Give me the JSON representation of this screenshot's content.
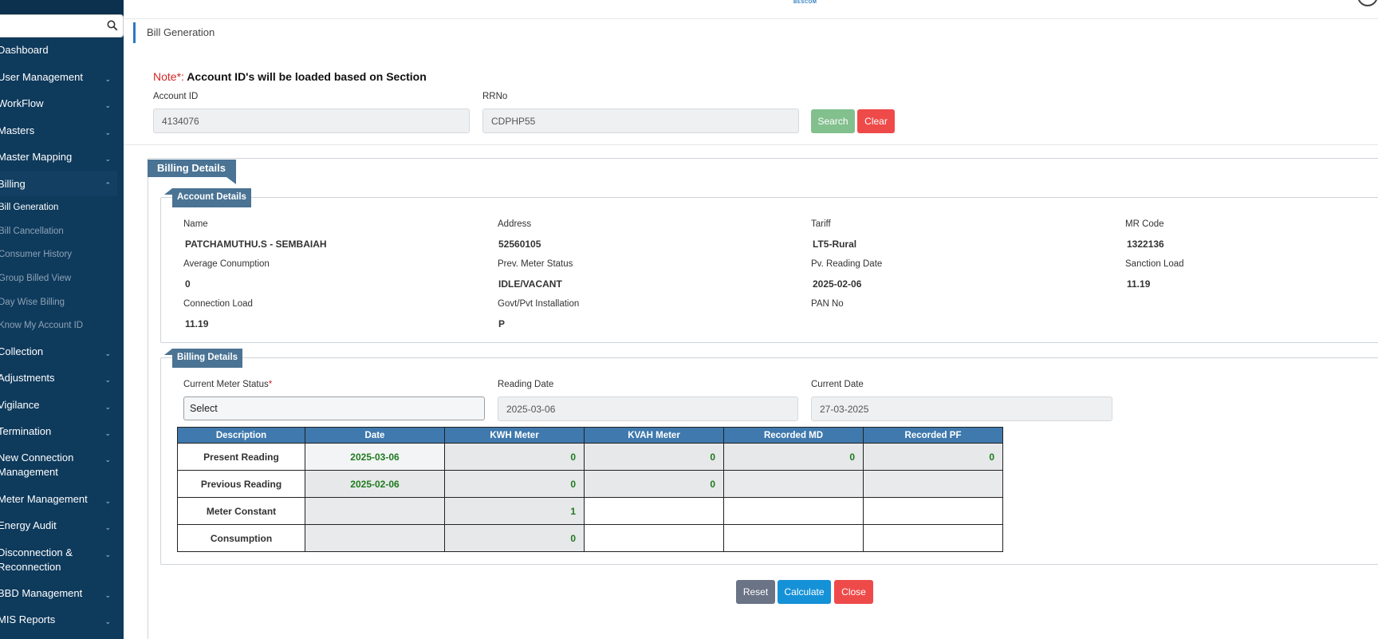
{
  "sidebar": {
    "search_placeholder": "",
    "items": [
      {
        "label": "Dashboard"
      },
      {
        "label": "User Management"
      },
      {
        "label": "WorkFlow"
      },
      {
        "label": "Masters"
      },
      {
        "label": "Master Mapping"
      },
      {
        "label": "Billing"
      },
      {
        "label": "Collection"
      },
      {
        "label": "Adjustments"
      },
      {
        "label": "Vigilance"
      },
      {
        "label": "Termination"
      },
      {
        "label": "New Connection"
      },
      {
        "label": "Management"
      },
      {
        "label": "Meter Management"
      },
      {
        "label": "Energy Audit"
      },
      {
        "label": "Disconnection &"
      },
      {
        "label": "Reconnection"
      },
      {
        "label": "BBD Management"
      },
      {
        "label": "MIS Reports"
      }
    ],
    "billing_sub": [
      {
        "label": "Bill Generation"
      },
      {
        "label": "Bill Cancellation"
      },
      {
        "label": "Consumer History"
      },
      {
        "label": "Group Billed View"
      },
      {
        "label": "Day Wise Billing"
      },
      {
        "label": "Know My Account ID"
      }
    ]
  },
  "header": {
    "logo_text": "BESCOM"
  },
  "breadcrumb": {
    "title": "Bill Generation"
  },
  "note": {
    "prefix": "Note*:",
    "text": " Account ID's will be loaded based on Section"
  },
  "search_form": {
    "account_id_label": "Account ID",
    "account_id_value": "4134076",
    "rrno_label": "RRNo",
    "rrno_value": "CDPHP55",
    "search_label": "Search",
    "clear_label": "Clear"
  },
  "billing_details_title": "Billing Details",
  "account_details": {
    "title": "Account Details",
    "fields": [
      {
        "label": "Name",
        "value": "PATCHAMUTHU.S - SEMBAIAH"
      },
      {
        "label": "Address",
        "value": "52560105"
      },
      {
        "label": "Tariff",
        "value": "LT5-Rural"
      },
      {
        "label": "MR Code",
        "value": "1322136"
      },
      {
        "label": "Average Conumption",
        "value": "0"
      },
      {
        "label": "Prev. Meter Status",
        "value": "IDLE/VACANT"
      },
      {
        "label": "Pv. Reading Date",
        "value": "2025-02-06"
      },
      {
        "label": "Sanction Load",
        "value": "11.19"
      },
      {
        "label": "Connection Load",
        "value": "11.19"
      },
      {
        "label": "Govt/Pvt Installation",
        "value": "P"
      },
      {
        "label": "PAN No",
        "value": ""
      }
    ]
  },
  "billing_form": {
    "title": "Billing Details",
    "meter_status_label": "Current Meter Status",
    "meter_status_required": "*",
    "meter_status_value": "Select",
    "reading_date_label": "Reading Date",
    "reading_date_value": "2025-03-06",
    "current_date_label": "Current Date",
    "current_date_value": "27-03-2025"
  },
  "readings_table": {
    "headers": [
      "Description",
      "Date",
      "KWH Meter",
      "KVAH Meter",
      "Recorded MD",
      "Recorded PF"
    ],
    "rows": [
      {
        "desc": "Present Reading",
        "date": "2025-03-06",
        "kwh": "0",
        "kvah": "0",
        "md": "0",
        "pf": "0"
      },
      {
        "desc": "Previous Reading",
        "date": "2025-02-06",
        "kwh": "0",
        "kvah": "0",
        "md": "",
        "pf": ""
      },
      {
        "desc": "Meter Constant",
        "date": "",
        "kwh": "1",
        "kvah": "",
        "md": "",
        "pf": ""
      },
      {
        "desc": "Consumption",
        "date": "",
        "kwh": "0",
        "kvah": "",
        "md": "",
        "pf": ""
      }
    ]
  },
  "actions": {
    "reset_label": "Reset",
    "calculate_label": "Calculate",
    "close_label": "Close"
  }
}
